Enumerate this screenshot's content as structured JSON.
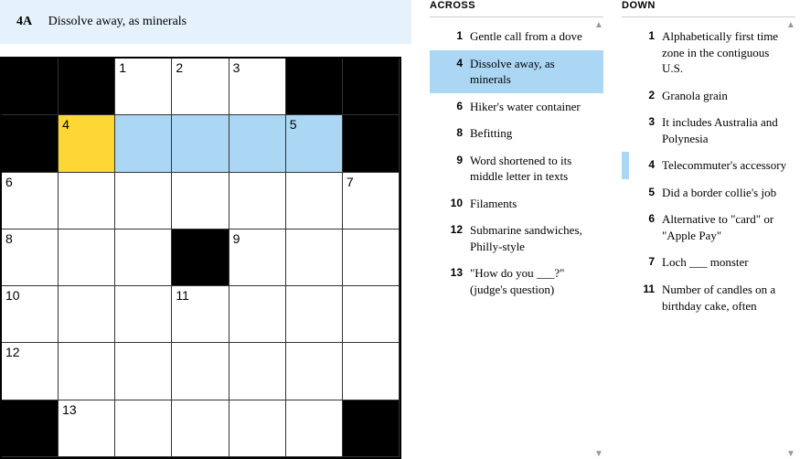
{
  "current_clue": {
    "number": "4A",
    "text": "Dissolve away, as minerals"
  },
  "grid": {
    "rows": 7,
    "cols": 7,
    "cells": [
      {
        "r": 0,
        "c": 0,
        "black": true
      },
      {
        "r": 0,
        "c": 1,
        "black": true
      },
      {
        "r": 0,
        "c": 2,
        "num": "1"
      },
      {
        "r": 0,
        "c": 3,
        "num": "2"
      },
      {
        "r": 0,
        "c": 4,
        "num": "3"
      },
      {
        "r": 0,
        "c": 5,
        "black": true
      },
      {
        "r": 0,
        "c": 6,
        "black": true
      },
      {
        "r": 1,
        "c": 0,
        "black": true
      },
      {
        "r": 1,
        "c": 1,
        "num": "4",
        "active": true
      },
      {
        "r": 1,
        "c": 2,
        "hl": true
      },
      {
        "r": 1,
        "c": 3,
        "hl": true
      },
      {
        "r": 1,
        "c": 4,
        "hl": true
      },
      {
        "r": 1,
        "c": 5,
        "num": "5",
        "hl": true
      },
      {
        "r": 1,
        "c": 6,
        "black": true
      },
      {
        "r": 2,
        "c": 0,
        "num": "6"
      },
      {
        "r": 2,
        "c": 1
      },
      {
        "r": 2,
        "c": 2
      },
      {
        "r": 2,
        "c": 3
      },
      {
        "r": 2,
        "c": 4
      },
      {
        "r": 2,
        "c": 5
      },
      {
        "r": 2,
        "c": 6,
        "num": "7"
      },
      {
        "r": 3,
        "c": 0,
        "num": "8"
      },
      {
        "r": 3,
        "c": 1
      },
      {
        "r": 3,
        "c": 2
      },
      {
        "r": 3,
        "c": 3,
        "black": true
      },
      {
        "r": 3,
        "c": 4,
        "num": "9"
      },
      {
        "r": 3,
        "c": 5
      },
      {
        "r": 3,
        "c": 6
      },
      {
        "r": 4,
        "c": 0,
        "num": "10"
      },
      {
        "r": 4,
        "c": 1
      },
      {
        "r": 4,
        "c": 2
      },
      {
        "r": 4,
        "c": 3,
        "num": "11"
      },
      {
        "r": 4,
        "c": 4
      },
      {
        "r": 4,
        "c": 5
      },
      {
        "r": 4,
        "c": 6
      },
      {
        "r": 5,
        "c": 0,
        "num": "12"
      },
      {
        "r": 5,
        "c": 1
      },
      {
        "r": 5,
        "c": 2
      },
      {
        "r": 5,
        "c": 3
      },
      {
        "r": 5,
        "c": 4
      },
      {
        "r": 5,
        "c": 5
      },
      {
        "r": 5,
        "c": 6
      },
      {
        "r": 6,
        "c": 0,
        "black": true
      },
      {
        "r": 6,
        "c": 1,
        "num": "13"
      },
      {
        "r": 6,
        "c": 2
      },
      {
        "r": 6,
        "c": 3
      },
      {
        "r": 6,
        "c": 4
      },
      {
        "r": 6,
        "c": 5
      },
      {
        "r": 6,
        "c": 6,
        "black": true
      }
    ]
  },
  "across": {
    "label": "ACROSS",
    "clues": [
      {
        "num": "1",
        "text": "Gentle call from a dove"
      },
      {
        "num": "4",
        "text": "Dissolve away, as minerals",
        "selected": true
      },
      {
        "num": "6",
        "text": "Hiker's water container"
      },
      {
        "num": "8",
        "text": "Befitting"
      },
      {
        "num": "9",
        "text": "Word shortened to its middle letter in texts"
      },
      {
        "num": "10",
        "text": "Filaments"
      },
      {
        "num": "12",
        "text": "Submarine sandwiches, Philly-style"
      },
      {
        "num": "13",
        "text": "\"How do you ___?\" (judge's question)"
      }
    ]
  },
  "down": {
    "label": "DOWN",
    "clues": [
      {
        "num": "1",
        "text": "Alphabetically first time zone in the contiguous U.S."
      },
      {
        "num": "2",
        "text": "Granola grain"
      },
      {
        "num": "3",
        "text": "It includes Australia and Polynesia"
      },
      {
        "num": "4",
        "text": "Telecommuter's accessory",
        "secondary": true
      },
      {
        "num": "5",
        "text": "Did a border collie's job"
      },
      {
        "num": "6",
        "text": "Alternative to \"card\" or \"Apple Pay\""
      },
      {
        "num": "7",
        "text": "Loch ___ monster"
      },
      {
        "num": "11",
        "text": "Number of candles on a birthday cake, often"
      }
    ]
  }
}
